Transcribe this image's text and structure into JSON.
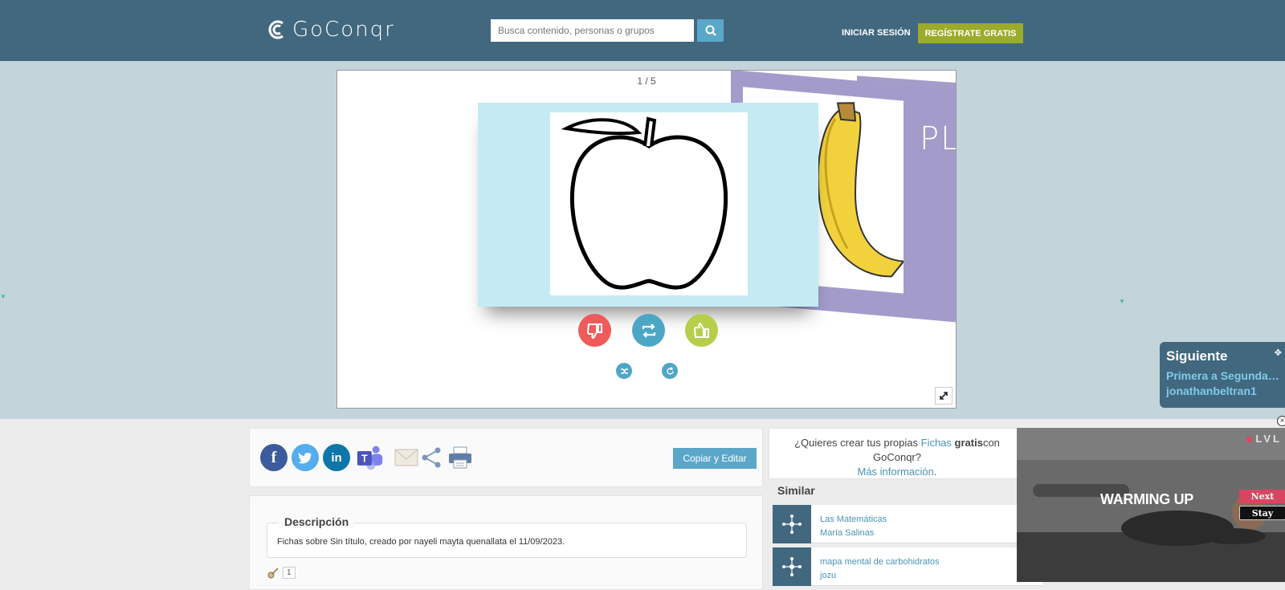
{
  "header": {
    "logo_text": "GoConqr",
    "search_placeholder": "Busca contenido, personas o grupos",
    "login_label": "INICIAR SESIÓN",
    "register_label": "REGÍSTRATE GRATIS"
  },
  "viewer": {
    "counter": "1 / 5",
    "back_card_text": "PLA"
  },
  "next_panel": {
    "title": "Siguiente",
    "item": "Primera a Segunda G...",
    "author": "jonathanbeltran1"
  },
  "share": {
    "copy_label": "Copiar y Editar"
  },
  "description": {
    "legend": "Descripción",
    "text": "Fichas sobre Sin título, creado por nayeli mayta quenallata el 11/09/2023.",
    "likes": "1"
  },
  "promo": {
    "prefix": "¿Quieres crear tus propias ",
    "link": "Fichas",
    "bold": "gratis",
    "suffix": "con GoConqr?",
    "more": "Más información"
  },
  "similar": {
    "title": "Similar",
    "items": [
      {
        "title": "Las Matemáticas",
        "author": "María Salinas"
      },
      {
        "title": "mapa mental de carbohidratos",
        "author": "jozu"
      }
    ]
  },
  "ad": {
    "logo": "LVL",
    "title": "WARMING UP",
    "next_label": "Next",
    "stay_label": "Stay"
  },
  "colors": {
    "header_bg": "#41687f",
    "accent_blue": "#5aa7c9",
    "register_green": "#9bab2c",
    "dislike_red": "#ef5b5b",
    "like_green": "#b5cf4c"
  }
}
